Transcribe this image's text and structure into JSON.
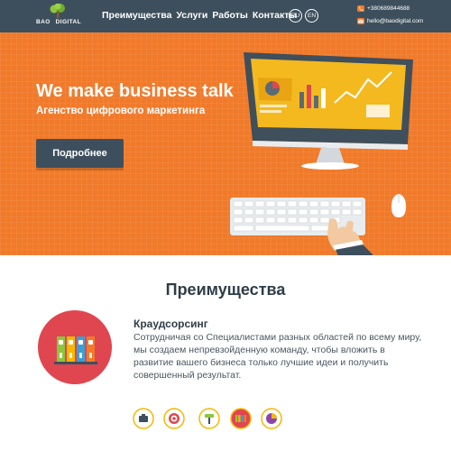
{
  "header": {
    "logo_text_1": "BAO",
    "logo_text_2": "DIGITAL",
    "nav": [
      "Преимущества",
      "Услуги",
      "Работы",
      "Контакты"
    ],
    "languages": [
      "RU",
      "EN"
    ],
    "phone": "+380689844688",
    "email": "hello@baodigital.com"
  },
  "hero": {
    "title": "We make business talk",
    "subtitle": "Агенство цифрового маркетинга",
    "button_label": "Подробнее",
    "background_color": "#f07a2a"
  },
  "advantages": {
    "section_title": "Преимущества",
    "feature_title": "Краудсорсинг",
    "feature_text": "Сотрудничая со Специалистами разных областей по всему миру, мы создаем непревзойденную команду, чтобы вложить в развитие вашего бизнеса только лучшие идеи и получить совершенный результат.",
    "feature_icon": "binders-icon",
    "carousel_icons": [
      "briefcase-icon",
      "target-icon",
      "paint-roller-icon",
      "binders-icon",
      "pie-chart-icon"
    ],
    "active_index": 3
  },
  "colors": {
    "header": "#3d4f5c",
    "accent": "#f07a2a",
    "feature_circle": "#e0464f",
    "dot_ring": "#f5b800"
  }
}
